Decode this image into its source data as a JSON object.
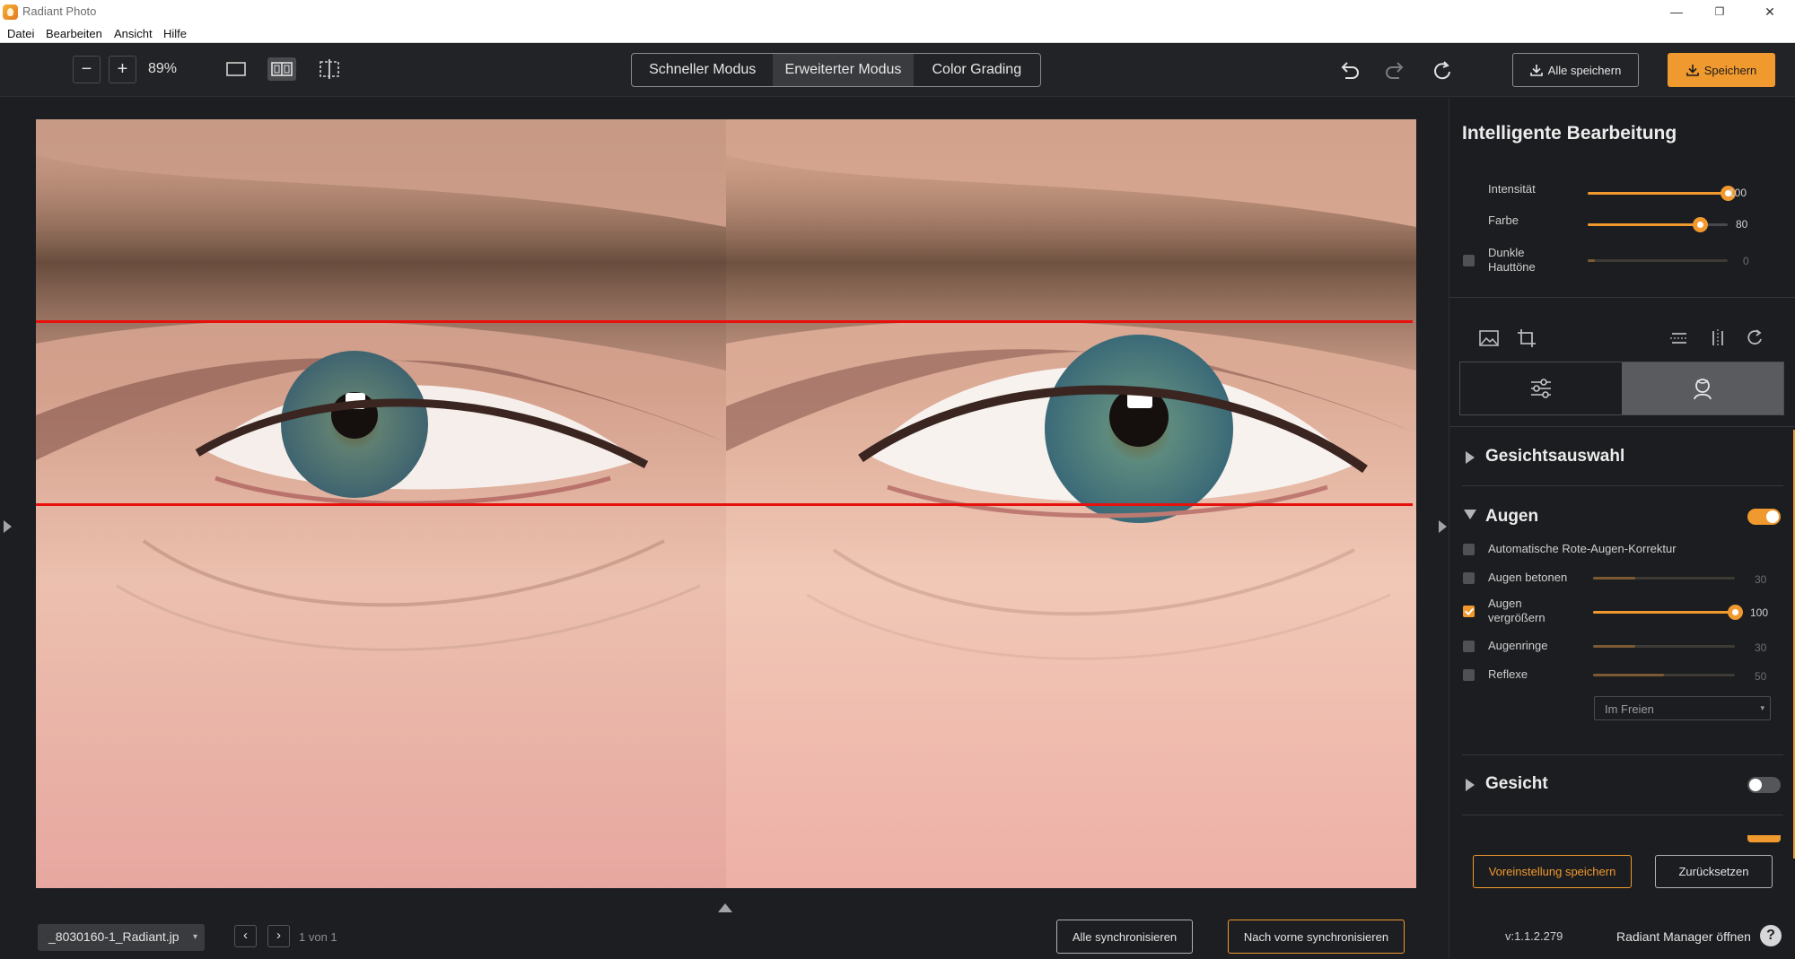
{
  "window": {
    "title": "Radiant Photo",
    "controls": {
      "minimize": "—",
      "maximize": "❐",
      "close": "✕"
    }
  },
  "menu": [
    "Datei",
    "Bearbeiten",
    "Ansicht",
    "Hilfe"
  ],
  "toolbar": {
    "zoom_out": "−",
    "zoom_in": "+",
    "zoom_value": "89%",
    "modes": [
      {
        "label": "Schneller Modus",
        "active": false
      },
      {
        "label": "Erweiterter Modus",
        "active": true
      },
      {
        "label": "Color Grading",
        "active": false
      }
    ],
    "save_all_label": "Alle speichern",
    "save_label": "Speichern"
  },
  "panel": {
    "title": "Intelligente Bearbeitung",
    "smart_sliders": [
      {
        "label": "Intensität",
        "value": "100",
        "fraction": 1.0
      },
      {
        "label": "Farbe",
        "value": "80",
        "fraction": 0.8
      }
    ],
    "dark_skin": {
      "label": "Dunkle Hauttöne",
      "value": "0",
      "checked": false
    },
    "sections": {
      "face_selection": "Gesichtsauswahl",
      "eyes": "Augen",
      "face": "Gesicht"
    },
    "eyes_enabled": true,
    "face_enabled": false,
    "eye_options": [
      {
        "label": "Automatische Rote-Augen-Korrektur",
        "checked": false
      },
      {
        "label": "Augen betonen",
        "value": "30",
        "fraction": 0.3,
        "checked": false
      },
      {
        "label": "Augen vergrößern",
        "value": "100",
        "fraction": 1.0,
        "checked": true
      },
      {
        "label": "Augenringe",
        "value": "30",
        "fraction": 0.3,
        "checked": false
      },
      {
        "label": "Reflexe",
        "value": "50",
        "fraction": 0.5,
        "checked": false
      }
    ],
    "reflex_preset": "Im Freien",
    "save_preset_label": "Voreinstellung speichern",
    "reset_label": "Zurücksetzen",
    "version": "v:1.1.2.279",
    "manager_label": "Radiant Manager öffnen",
    "help": "?"
  },
  "bottom": {
    "filename": "_8030160-1_Radiant.jp",
    "prev": "‹",
    "next": "›",
    "page_count": "1 von 1",
    "sync_all_label": "Alle synchronisieren",
    "sync_forward_label": "Nach vorne synchronisieren"
  },
  "colors": {
    "accent": "#f0992f",
    "guide_line": "#e8100d",
    "background": "#1d1e21"
  }
}
